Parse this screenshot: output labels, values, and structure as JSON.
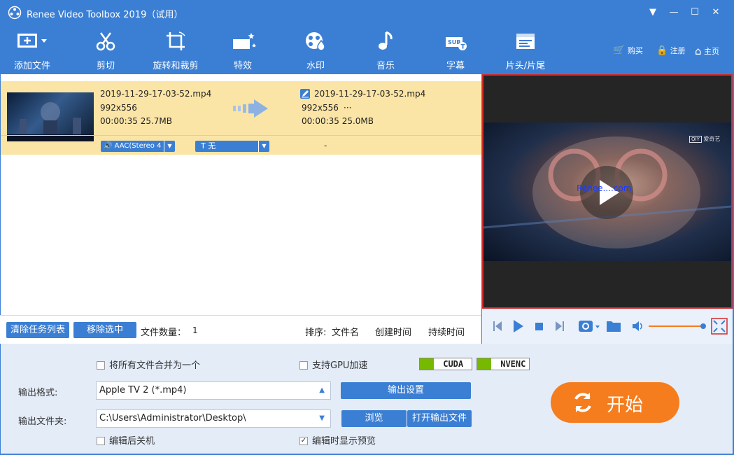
{
  "app": {
    "title": "Renee Video Toolbox 2019（试用）"
  },
  "toolbar": {
    "items": [
      {
        "label": "添加文件",
        "icon": "add-file-icon"
      },
      {
        "label": "剪切",
        "icon": "scissors-icon"
      },
      {
        "label": "旋转和裁剪",
        "icon": "crop-rotate-icon"
      },
      {
        "label": "特效",
        "icon": "effects-icon"
      },
      {
        "label": "水印",
        "icon": "watermark-icon"
      },
      {
        "label": "音乐",
        "icon": "music-icon"
      },
      {
        "label": "字幕",
        "icon": "subtitle-icon"
      },
      {
        "label": "片头/片尾",
        "icon": "intro-outro-icon"
      }
    ],
    "buy": "购买",
    "register": "注册",
    "home": "主页"
  },
  "file": {
    "src_name": "2019-11-29-17-03-52.mp4",
    "src_res": "992x556",
    "src_info": "00:00:35 25.7MB",
    "dst_name": "2019-11-29-17-03-52.mp4",
    "dst_res": "992x556",
    "dst_more": "···",
    "dst_info": "00:00:35 25.0MB",
    "audio": "AAC(Stereo 4",
    "subtitle": "T 无",
    "dash": "-"
  },
  "preview": {
    "watermark_brand": "爱奇艺",
    "watermark_text": "Renee....com"
  },
  "list_actions": {
    "clear": "清除任务列表",
    "remove": "移除选中",
    "count_label": "文件数量：",
    "count": "1",
    "sort_label": "排序:",
    "sort_name": "文件名",
    "sort_created": "创建时间",
    "sort_duration": "持续时间"
  },
  "settings": {
    "merge_label": "将所有文件合并为一个",
    "merge_checked": false,
    "gpu_label": "支持GPU加速",
    "gpu_checked": false,
    "cuda": "CUDA",
    "nvenc": "NVENC",
    "format_label": "输出格式:",
    "format_value": "Apple TV 2 (*.mp4)",
    "output_settings": "输出设置",
    "folder_label": "输出文件夹:",
    "folder_value": "C:\\Users\\Administrator\\Desktop\\",
    "browse": "浏览",
    "open_output": "打开输出文件",
    "shutdown_label": "编辑后关机",
    "shutdown_checked": false,
    "preview_label": "编辑时显示预览",
    "preview_checked": true,
    "start": "开始"
  },
  "colors": {
    "accent": "#3b7fd4",
    "start": "#f57d1e",
    "row": "#fbe5a6",
    "border": "#d12b2b"
  }
}
